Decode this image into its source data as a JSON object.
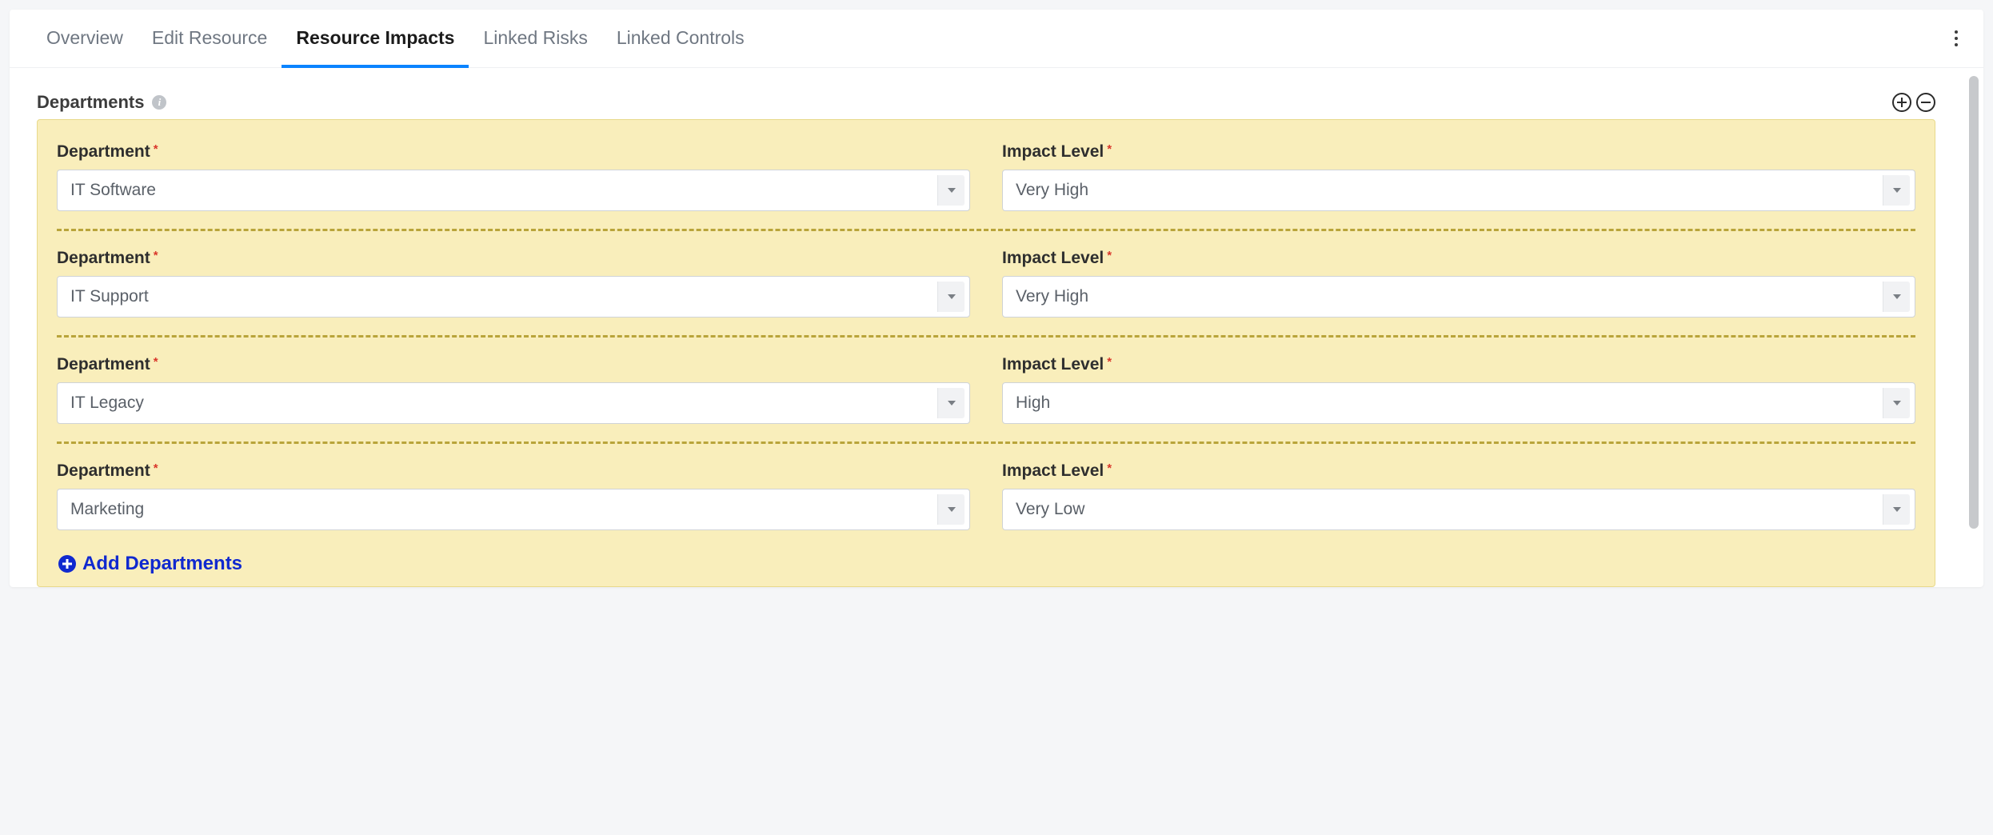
{
  "tabs": [
    {
      "label": "Overview",
      "active": false
    },
    {
      "label": "Edit Resource",
      "active": false
    },
    {
      "label": "Resource Impacts",
      "active": true
    },
    {
      "label": "Linked Risks",
      "active": false
    },
    {
      "label": "Linked Controls",
      "active": false
    }
  ],
  "section": {
    "title": "Departments",
    "add_label": "Add Departments",
    "field_labels": {
      "department": "Department",
      "impact_level": "Impact Level"
    }
  },
  "rows": [
    {
      "department": "IT Software",
      "impact_level": "Very High"
    },
    {
      "department": "IT Support",
      "impact_level": "Very High"
    },
    {
      "department": "IT Legacy",
      "impact_level": "High"
    },
    {
      "department": "Marketing",
      "impact_level": "Very Low"
    }
  ]
}
